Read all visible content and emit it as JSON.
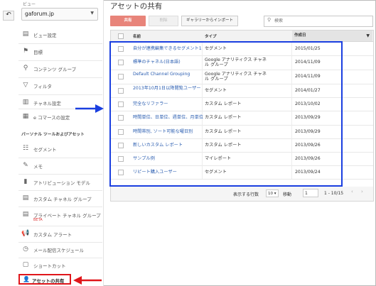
{
  "sidebar": {
    "view_label": "ビュー",
    "property": "gaforum.jp",
    "items": [
      {
        "icon": "view-settings-icon",
        "label": "ビュー設定",
        "glyph": "▤"
      },
      {
        "icon": "flag-icon",
        "label": "目標",
        "glyph": "⚑"
      },
      {
        "icon": "content-group-icon",
        "label": "コンテンツ グループ",
        "glyph": "⚲"
      },
      {
        "icon": "filter-icon",
        "label": "フィルタ",
        "glyph": "▽"
      },
      {
        "icon": "channel-settings-icon",
        "label": "チャネル設定",
        "glyph": "▥"
      },
      {
        "icon": "ecommerce-icon",
        "label": "e コマースの設定",
        "glyph": "▦"
      }
    ],
    "personal_section_label": "パーソナル ツールおよびアセット",
    "personal_items": [
      {
        "icon": "segment-icon",
        "label": "セグメント",
        "glyph": "☷"
      },
      {
        "icon": "memo-icon",
        "label": "メモ",
        "glyph": "✎"
      },
      {
        "icon": "attribution-icon",
        "label": "アトリビューション モデル",
        "glyph": "▮"
      },
      {
        "icon": "custom-channel-group-icon",
        "label": "カスタム チャネル グループ",
        "glyph": "▤"
      },
      {
        "icon": "private-channel-group-icon",
        "label": "プライベート チャネル グループ",
        "glyph": "▤",
        "badge": "BETA"
      },
      {
        "icon": "custom-alert-icon",
        "label": "カスタム アラート",
        "glyph": "📢"
      },
      {
        "icon": "email-schedule-icon",
        "label": "メール配信スケジュール",
        "glyph": "◷"
      },
      {
        "icon": "shortcut-icon",
        "label": "ショートカット",
        "glyph": "▢"
      }
    ],
    "active_item": {
      "icon": "share-assets-icon",
      "label": "アセットの共有",
      "glyph": "👤"
    }
  },
  "main": {
    "title": "アセットの共有",
    "toolbar": {
      "new_label": "共有",
      "grey_label": "削除",
      "gallery_label": "ギャラリーからインポート",
      "search_placeholder": "検索"
    },
    "table": {
      "headers": {
        "name": "名前",
        "type": "タイプ",
        "created": "作成日"
      },
      "rows": [
        {
          "name": "自分が連携編集できるセグメント1",
          "type": "セグメント",
          "created": "2015/01/25"
        },
        {
          "name": "標準のチャネル(日本語)",
          "type": "Google アナリティクス チャネル グループ",
          "created": "2014/11/09"
        },
        {
          "name": "Default Channel Grouping",
          "type": "Google アナリティクス チャネル グループ",
          "created": "2014/11/09"
        },
        {
          "name": "2013年10月1日以降閲覧ユーザー",
          "type": "セグメント",
          "created": "2014/01/27"
        },
        {
          "name": "完全なリファラー",
          "type": "カスタム レポート",
          "created": "2013/10/02"
        },
        {
          "name": "時間単位、日単位、週単位、月単位",
          "type": "カスタム レポート",
          "created": "2013/09/29"
        },
        {
          "name": "時間帯別, ソート可能な曜日別",
          "type": "カスタム レポート",
          "created": "2013/09/29"
        },
        {
          "name": "新しいカスタム レポート",
          "type": "カスタム レポート",
          "created": "2013/09/26"
        },
        {
          "name": "サンプル例",
          "type": "マイレポート",
          "created": "2013/09/26"
        },
        {
          "name": "リピート購入ユーザー",
          "type": "セグメント",
          "created": "2013/09/24"
        }
      ]
    },
    "pager": {
      "rows_label": "表示する行数",
      "rows_value": "10",
      "goto_label": "移動",
      "goto_value": "1",
      "range": "1 - 10/15"
    }
  },
  "colors": {
    "highlight_blue": "#1a3fe0",
    "highlight_red": "#e0161b",
    "link": "#2a5db0",
    "new_button": "#e8847a"
  }
}
